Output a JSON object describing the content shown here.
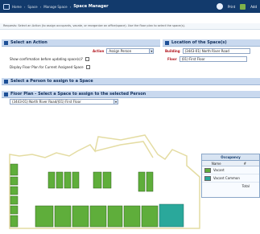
{
  "topbar": {
    "breadcrumb": [
      "Home",
      "Space",
      "Manage Space",
      "Space Manager"
    ],
    "print_label": "Print",
    "add_label": "Add"
  },
  "instructions": "Requests: Select an Action (to assign occupants, vacate, or reorganize an office/space). Use the floor plan to select the space(s).",
  "action_panel": {
    "title": "Select an Action",
    "action_label": "Action",
    "action_value": "Assign Person",
    "confirm_label": "Show confirmation before updating space(s)?",
    "display_label": "Display Floor Plan for Current Assigned Space"
  },
  "location_panel": {
    "title": "Location of the Space(s)",
    "building_label": "Building",
    "building_value": "(3443-01) North River Road",
    "floor_label": "Floor",
    "floor_value": "(01) First Floor"
  },
  "person_panel": {
    "title": "Select a Person to assign to a Space"
  },
  "floorplan_panel": {
    "title": "Floor Plan - Select a Space to assign to the selected Person",
    "filter_value": "(3443-01) North River Road/(01) First Floor"
  },
  "legend": {
    "title": "Occupancy",
    "col_name": "Name",
    "col_count": "#",
    "rows": [
      {
        "name": "Vacant",
        "color": "#5fae3b"
      },
      {
        "name": "Vacant Common",
        "color": "#2aa89b"
      }
    ],
    "total_label": "Total"
  },
  "colors": {
    "vacant": "#5fae3b",
    "vacant_common": "#2aa89b",
    "outline": "#e4dca2"
  }
}
